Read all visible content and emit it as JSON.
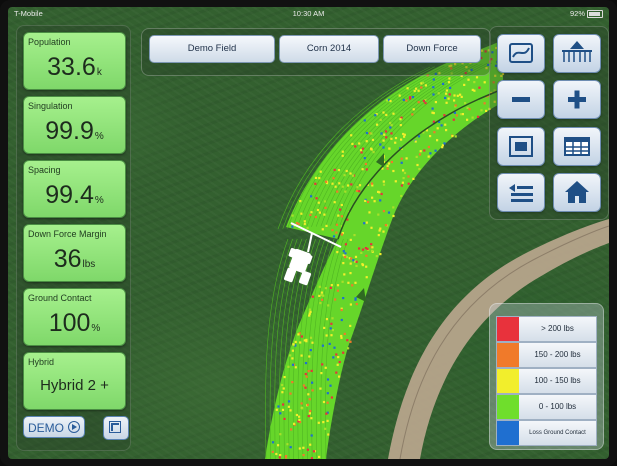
{
  "status_bar": {
    "carrier": "T-Mobile",
    "time": "10:30 AM",
    "battery": "92%",
    "battery_level": 0.92
  },
  "metrics": [
    {
      "label": "Population",
      "value": "33.6",
      "unit": "k"
    },
    {
      "label": "Singulation",
      "value": "99.9",
      "unit": "%"
    },
    {
      "label": "Spacing",
      "value": "99.4",
      "unit": "%"
    },
    {
      "label": "Down Force Margin",
      "value": "36",
      "unit": "lbs"
    },
    {
      "label": "Ground Contact",
      "value": "100",
      "unit": "%"
    }
  ],
  "hybrid": {
    "label": "Hybrid",
    "value": "Hybrid 2 +"
  },
  "demo_button": {
    "label": "DEMO",
    "icon": "play-circle-icon"
  },
  "expand_button": {
    "icon": "expand-arrow-icon"
  },
  "tabs": [
    {
      "label": "Demo Field"
    },
    {
      "label": "Corn 2014"
    },
    {
      "label": "Down Force"
    }
  ],
  "controls": [
    {
      "name": "map-layer-button",
      "icon": "map-layer-icon"
    },
    {
      "name": "planter-button",
      "icon": "planter-icon"
    },
    {
      "name": "zoom-out-button",
      "icon": "minus-icon"
    },
    {
      "name": "zoom-in-button",
      "icon": "plus-icon"
    },
    {
      "name": "fit-view-button",
      "icon": "fit-view-icon"
    },
    {
      "name": "table-view-button",
      "icon": "table-icon"
    },
    {
      "name": "list-button",
      "icon": "list-icon"
    },
    {
      "name": "home-button",
      "icon": "home-icon"
    }
  ],
  "legend": [
    {
      "label": "> 200 lbs",
      "color": "#e8323c"
    },
    {
      "label": "150 - 200 lbs",
      "color": "#f07a2a"
    },
    {
      "label": "100 - 150 lbs",
      "color": "#f2ee2c"
    },
    {
      "label": "0 - 100 lbs",
      "color": "#6fde2c"
    },
    {
      "label": "Loss Ground Contact",
      "color": "#1f6fd0"
    }
  ],
  "map": {
    "band_color": "#66d62a",
    "road_color": "#b4a28a"
  }
}
